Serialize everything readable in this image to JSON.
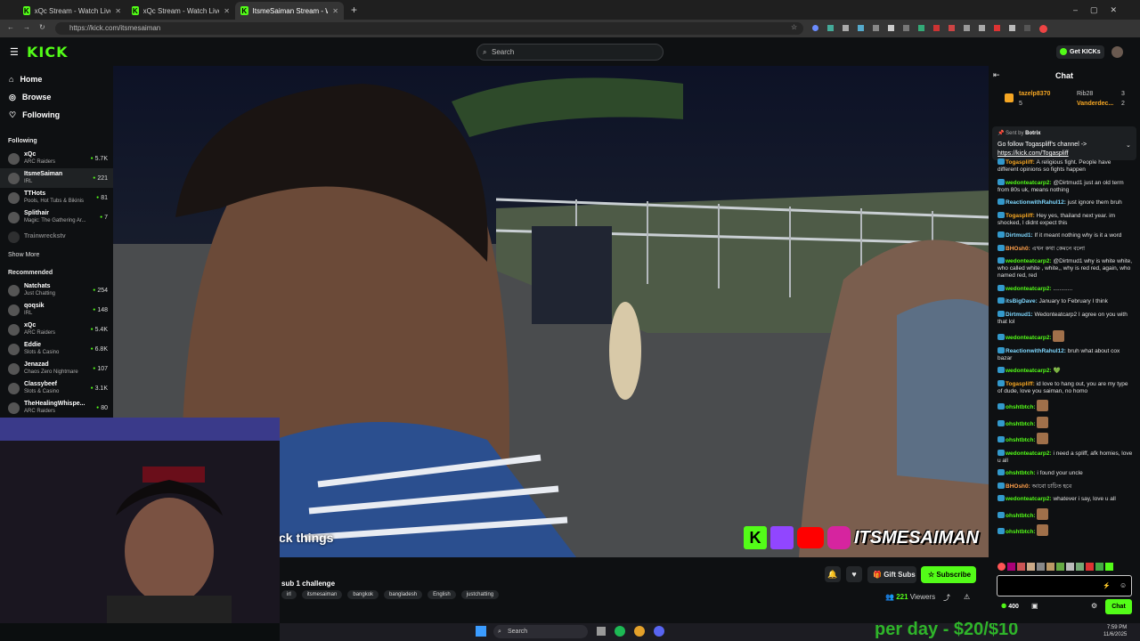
{
  "browser": {
    "tabs": [
      {
        "title": "xQc Stream - Watch Live on Kic",
        "active": false
      },
      {
        "title": "xQc Stream - Watch Live on Kic",
        "active": false
      },
      {
        "title": "ItsmeSaiman Stream - Watc",
        "active": true
      }
    ],
    "url": "https://kick.com/itsmesaiman"
  },
  "header": {
    "logo": "KICK",
    "search_placeholder": "Search",
    "get_kicks": "Get KICKs"
  },
  "sidebar": {
    "nav": [
      {
        "label": "Home",
        "icon": "home-icon"
      },
      {
        "label": "Browse",
        "icon": "compass-icon"
      },
      {
        "label": "Following",
        "icon": "heart-icon"
      }
    ],
    "following_label": "Following",
    "following": [
      {
        "name": "xQc",
        "category": "ARC Raiders",
        "viewers": "5.7K"
      },
      {
        "name": "ItsmeSaiman",
        "category": "IRL",
        "viewers": "221"
      },
      {
        "name": "TTHots",
        "category": "Pools, Hot Tubs & Bikinis",
        "viewers": "81"
      },
      {
        "name": "Splithair",
        "category": "Magic: The Gathering Ar...",
        "viewers": "7"
      },
      {
        "name": "Trainwreckstv",
        "category": "",
        "viewers": ""
      }
    ],
    "show_more": "Show More",
    "recommended_label": "Recommended",
    "recommended": [
      {
        "name": "Natchats",
        "category": "Just Chatting",
        "viewers": "254"
      },
      {
        "name": "qoqsik",
        "category": "IRL",
        "viewers": "148"
      },
      {
        "name": "xQc",
        "category": "ARC Raiders",
        "viewers": "5.4K"
      },
      {
        "name": "Eddie",
        "category": "Slots & Casino",
        "viewers": "6.8K"
      },
      {
        "name": "Jenazad",
        "category": "Chaos Zero Nightmare",
        "viewers": "107"
      },
      {
        "name": "Classybeef",
        "category": "Slots & Casino",
        "viewers": "3.1K"
      },
      {
        "name": "TheHealingWhispe...",
        "category": "ARC Raiders",
        "viewers": "80"
      }
    ]
  },
  "video": {
    "caption": "ck things",
    "brand_overlay": "ITSMESAIMAN"
  },
  "stream_info": {
    "title": "sub 1 challenge",
    "tags": [
      "irl",
      "itsmesaiman",
      "bangkok",
      "bangladesh",
      "English",
      "justchatting"
    ],
    "gift_subs": "Gift Subs",
    "subscribe": "Subscribe",
    "viewers": "221",
    "viewers_label": "Viewers"
  },
  "webcam_overlay_text": "per day - $20/$10",
  "taskbar": {
    "search": "Search",
    "time": "7:59 PM",
    "date": "11/6/2025"
  },
  "chat": {
    "title": "Chat",
    "leaderboard": [
      {
        "name": "tazelp8370",
        "count": "5"
      },
      {
        "name": "Rib28",
        "count": "3"
      },
      {
        "name": "Vanderdec...",
        "count": "2"
      }
    ],
    "pinned": {
      "sent_by": "Sent by",
      "sender": "Botrix",
      "text": "Go follow Togaspliff's channel ->",
      "link": "https://kick.com/Togaspliff"
    },
    "messages": [
      {
        "user": "Togaspliff",
        "color": "#f5a623",
        "text": "A religious fight. People have different opinions so fights happen"
      },
      {
        "user": "wedonteatcarp2",
        "color": "#53fc18",
        "text": "@Dirtmud1 just an old term from 80s uk, means nothing"
      },
      {
        "user": "ReactionwithRahul12",
        "color": "#7fd8ff",
        "text": "just ignore them bruh"
      },
      {
        "user": "Togaspliff",
        "color": "#f5a623",
        "text": "Hey  yes, thailand next year. im shocked, I didnt expect this"
      },
      {
        "user": "Dirtmud1",
        "color": "#7fd8ff",
        "text": "If it meant nothing why is it a word"
      },
      {
        "user": "BHOsh0",
        "color": "#ff9f4a",
        "text": "এখন কথা কেমনে বলো"
      },
      {
        "user": "wedonteatcarp2",
        "color": "#53fc18",
        "text": "@Dirtmud1 why is white white, who called white , white,, why is red red, again, who named red, red"
      },
      {
        "user": "wedonteatcarp2",
        "color": "#53fc18",
        "text": "............"
      },
      {
        "user": "itsBigDave",
        "color": "#7fd8ff",
        "text": "January to February I think"
      },
      {
        "user": "Dirtmud1",
        "color": "#7fd8ff",
        "text": "Wedonteatcarp2 I agree on you with that lol"
      },
      {
        "user": "wedonteatcarp2",
        "color": "#53fc18",
        "text": ""
      },
      {
        "user": "ReactionwithRahul12",
        "color": "#7fd8ff",
        "text": "bruh what about cox bazar"
      },
      {
        "user": "wedonteatcarp2",
        "color": "#53fc18",
        "text": "💚"
      },
      {
        "user": "Togaspliff",
        "color": "#f5a623",
        "text": "id love to hang out, you are my type of dude, love you saiman, no homo"
      },
      {
        "user": "ohshtbtch",
        "color": "#53fc18",
        "text": ""
      },
      {
        "user": "ohshtbtch",
        "color": "#53fc18",
        "text": ""
      },
      {
        "user": "ohshtbtch",
        "color": "#53fc18",
        "text": ""
      },
      {
        "user": "wedonteatcarp2",
        "color": "#53fc18",
        "text": "i need a spliff, afk homies, love u all"
      },
      {
        "user": "ohshtbtch",
        "color": "#53fc18",
        "text": "i found your uncle"
      },
      {
        "user": "BHOsh0",
        "color": "#ff9f4a",
        "text": "আবো চাচিত হবে"
      },
      {
        "user": "wedonteatcarp2",
        "color": "#53fc18",
        "text": "whatever i say, love u all"
      },
      {
        "user": "ohshtbtch",
        "color": "#53fc18",
        "text": ""
      },
      {
        "user": "ohshtbtch",
        "color": "#53fc18",
        "text": ""
      }
    ],
    "kicks_balance": "400",
    "send_label": "Chat"
  },
  "colors": {
    "accent": "#53fc18",
    "bg": "#0e1012"
  }
}
